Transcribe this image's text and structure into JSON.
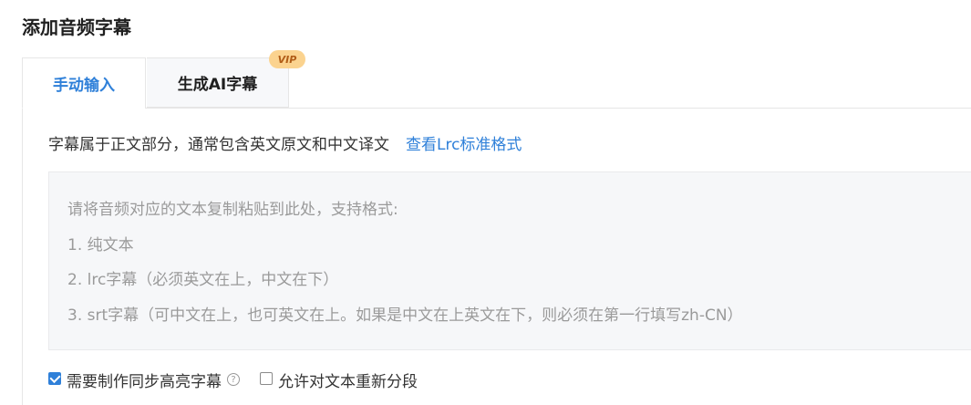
{
  "page": {
    "title": "添加音频字幕"
  },
  "tabs": [
    {
      "label": "手动输入",
      "active": true
    },
    {
      "label": "生成AI字幕",
      "active": false,
      "badge": "VIP"
    }
  ],
  "intro": {
    "text": "字幕属于正文部分，通常包含英文原文和中文译文",
    "link": "查看Lrc标准格式"
  },
  "textarea": {
    "placeholder": "请将音频对应的文本复制粘贴到此处，支持格式:\n1. 纯文本\n2. lrc字幕（必须英文在上，中文在下）\n3. srt字幕（可中文在上，也可英文在上。如果是中文在上英文在下，则必须在第一行填写zh-CN）"
  },
  "options": {
    "sync_highlight": {
      "label": "需要制作同步高亮字幕",
      "checked": true
    },
    "allow_resegment": {
      "label": "允许对文本重新分段",
      "checked": false
    }
  },
  "colors": {
    "accent": "#2f80d9",
    "vip_bg": "#fbd38f",
    "vip_text": "#b15d17"
  },
  "icons": {
    "help": "question-circle-icon",
    "check": "check-icon"
  }
}
